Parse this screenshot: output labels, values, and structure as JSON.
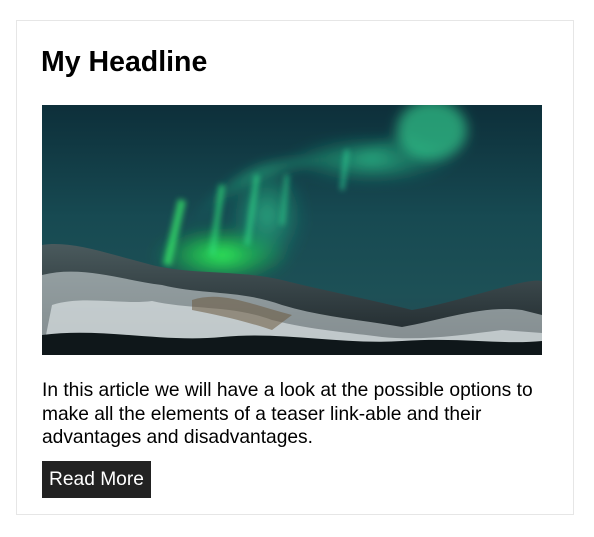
{
  "teaser": {
    "headline": "My Headline",
    "image_subject": "aurora-borealis-over-snowy-mountains",
    "body": "In this article we will have a look at the possible options to make all the elements of a teaser link-able and their advantages and disadvantages.",
    "button_label": "Read More"
  },
  "colors": {
    "button_background": "#222222",
    "button_text": "#ffffff",
    "card_border": "#e6e6e6",
    "aurora": "#29f07a"
  }
}
